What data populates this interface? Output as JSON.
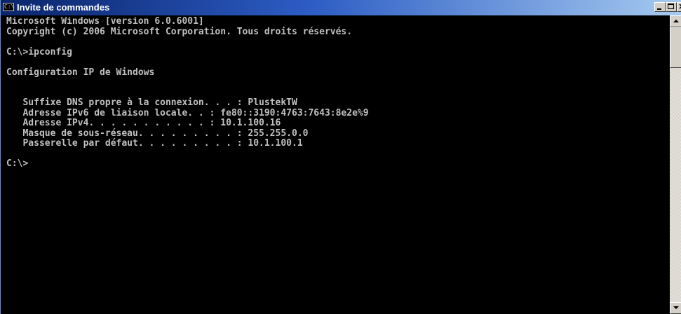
{
  "window": {
    "title": "Invite de commandes",
    "icon": "console-icon",
    "icon_glyph": "C:\\"
  },
  "controls": {
    "close_glyph": "×"
  },
  "console": {
    "lines": [
      "Microsoft Windows [version 6.0.6001]",
      "Copyright (c) 2006 Microsoft Corporation. Tous droits réservés.",
      "",
      "C:\\>ipconfig",
      "",
      "Configuration IP de Windows",
      "",
      "",
      "   Suffixe DNS propre à la connexion. . . : PlustekTW",
      "   Adresse IPv6 de liaison locale. . : fe80::3190:4763:7643:8e2e%9",
      "   Adresse IPv4. . . . . . . . . . . : 10.1.100.16",
      "   Masque de sous-réseau. . . . . . . . . : 255.255.0.0",
      "   Passerelle par défaut. . . . . . . . . : 10.1.100.1",
      "",
      "C:\\>"
    ]
  },
  "colors": {
    "background": "#000000",
    "text": "#c0c0c0",
    "titlebar_start": "#0a246a",
    "titlebar_end": "#a6caf0"
  }
}
